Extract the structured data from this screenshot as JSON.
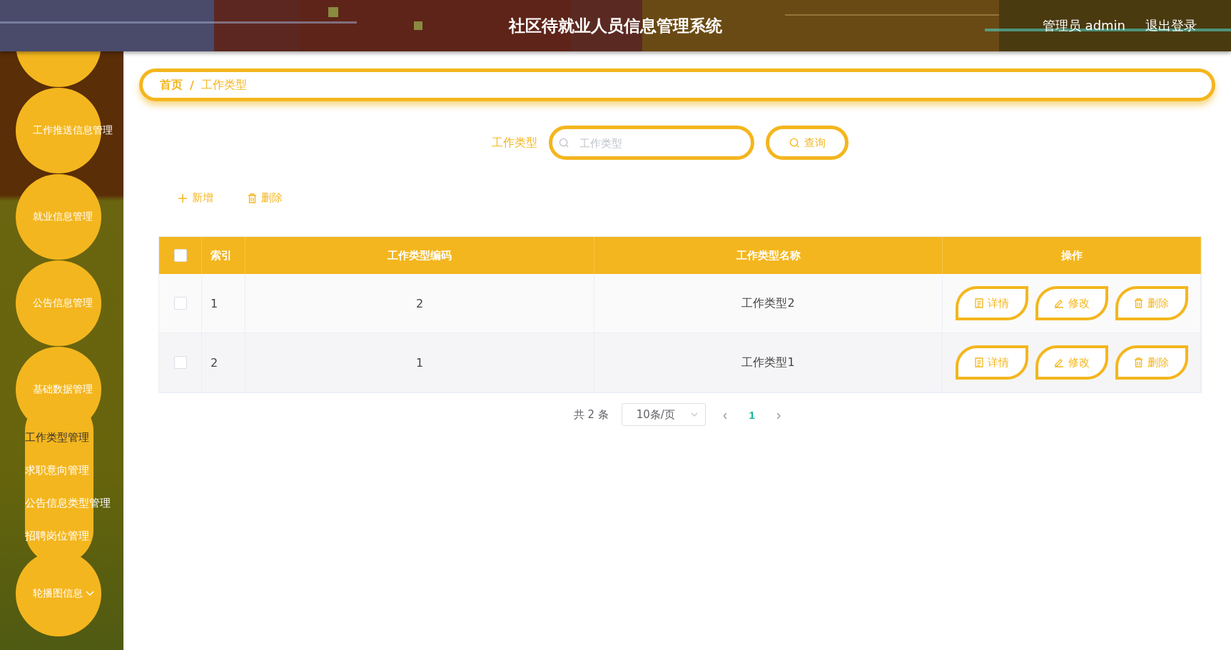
{
  "header": {
    "title": "社区待就业人员信息管理系统",
    "user": "管理员 admin",
    "logout": "退出登录"
  },
  "sidebar": {
    "items": [
      {
        "label": "工作推送信息管理",
        "chevron": false
      },
      {
        "label": "就业信息管理",
        "chevron": false
      },
      {
        "label": "公告信息管理",
        "chevron": false
      },
      {
        "label": "基础数据管理",
        "chevron": false,
        "children": [
          {
            "label": "工作类型管理",
            "selected": true
          },
          {
            "label": "求职意向管理",
            "selected": false
          },
          {
            "label": "公告信息类型管理",
            "selected": false
          },
          {
            "label": "招聘岗位管理",
            "selected": false
          }
        ]
      },
      {
        "label": "轮播图信息",
        "chevron": true
      }
    ]
  },
  "breadcrumb": {
    "items": [
      "首页",
      "工作类型"
    ],
    "separator": "/"
  },
  "search": {
    "label": "工作类型",
    "placeholder": "工作类型",
    "button": "查询"
  },
  "toolbar": [
    {
      "kind": "add",
      "label": "新增"
    },
    {
      "kind": "delete",
      "label": "删除"
    }
  ],
  "table": {
    "header_checked": false,
    "columns": [
      "索引",
      "工作类型编码",
      "工作类型名称",
      "操作"
    ],
    "rows": [
      {
        "checked": false,
        "index": "1",
        "code": "2",
        "name": "工作类型2",
        "actions": [
          {
            "kind": "detail",
            "label": "详情"
          },
          {
            "kind": "edit",
            "label": "修改"
          },
          {
            "kind": "delete",
            "label": "删除"
          }
        ]
      },
      {
        "checked": false,
        "index": "2",
        "code": "1",
        "name": "工作类型1",
        "actions": [
          {
            "kind": "detail",
            "label": "详情"
          },
          {
            "kind": "edit",
            "label": "修改"
          },
          {
            "kind": "delete",
            "label": "删除"
          }
        ]
      }
    ]
  },
  "pagination": {
    "total": "共 2 条",
    "page_size": "10条/页",
    "prev": "‹",
    "next": "›",
    "pages": [
      {
        "label": "1",
        "selected": true
      }
    ]
  }
}
